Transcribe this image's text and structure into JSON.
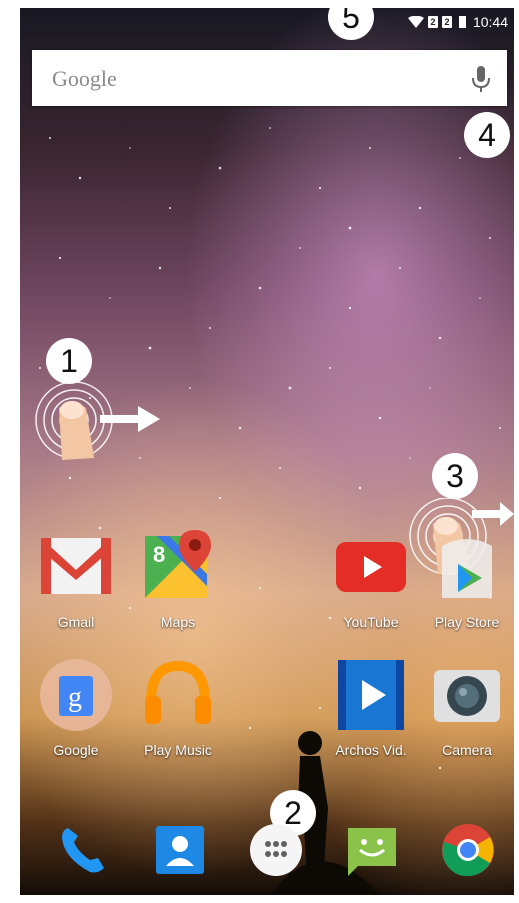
{
  "status_bar": {
    "sim1": "2",
    "sim2": "2",
    "time": "10:44"
  },
  "search": {
    "placeholder": "Google"
  },
  "callouts": [
    "1",
    "2",
    "3",
    "4",
    "5"
  ],
  "apps": [
    {
      "label": "Gmail",
      "icon": "gmail-icon"
    },
    {
      "label": "Maps",
      "icon": "maps-icon"
    },
    {
      "label": "YouTube",
      "icon": "youtube-icon"
    },
    {
      "label": "Play Store",
      "icon": "play-store-icon"
    },
    {
      "label": "Google",
      "icon": "google-folder-icon"
    },
    {
      "label": "Play Music",
      "icon": "play-music-icon"
    },
    {
      "label": "Archos Vid.",
      "icon": "archos-video-icon"
    },
    {
      "label": "Camera",
      "icon": "camera-icon"
    }
  ],
  "dock": [
    "phone-icon",
    "contacts-icon",
    "app-drawer-icon",
    "messaging-icon",
    "chrome-icon"
  ]
}
